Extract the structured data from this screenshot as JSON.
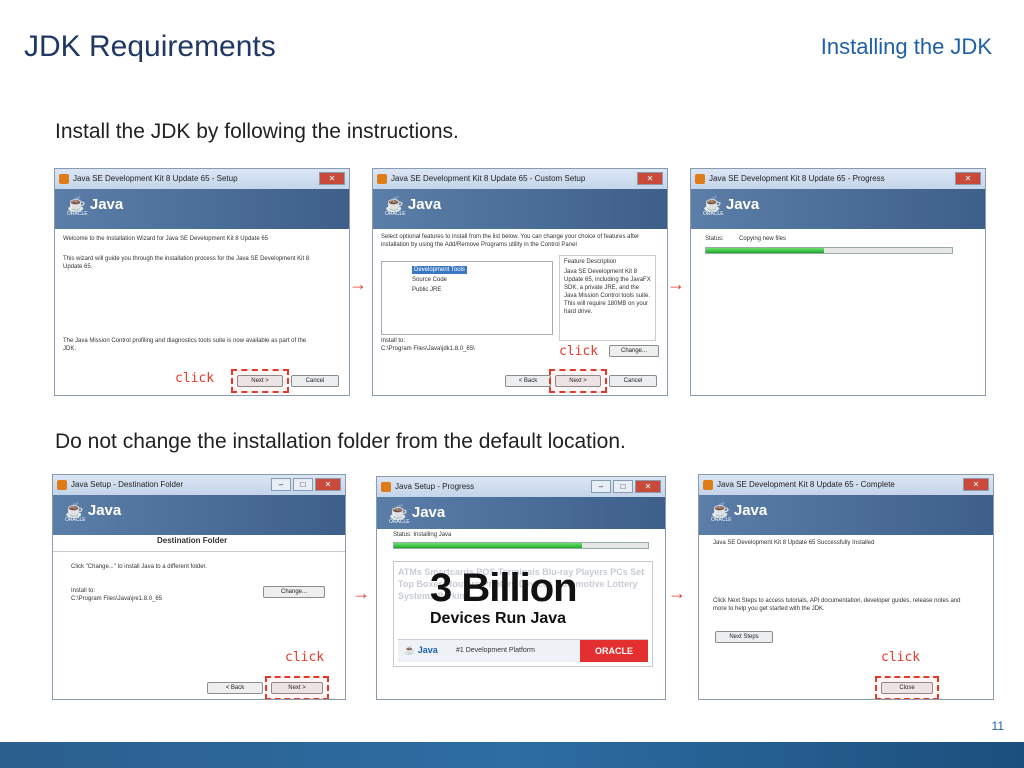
{
  "header": {
    "title": "JDK Requirements",
    "section": "Installing the JDK"
  },
  "instructions": {
    "step1": "Install the JDK by following the instructions.",
    "step2": "Do not change the installation folder from the default location."
  },
  "click_label": "click",
  "page_number": "11",
  "screenshots": {
    "s1": {
      "title": "Java SE Development Kit 8 Update 65 - Setup",
      "welcome": "Welcome to the Installation Wizard for Java SE Development Kit 8 Update 65",
      "body": "This wizard will guide you through the installation process for the Java SE Development Kit 8 Update 65.",
      "footer": "The Java Mission Control profiling and diagnostics tools suite is now available as part of the JDK.",
      "next": "Next >",
      "cancel": "Cancel"
    },
    "s2": {
      "title": "Java SE Development Kit 8 Update 65 - Custom Setup",
      "intro": "Select optional features to install from the list below. You can change your choice of features after installation by using the Add/Remove Programs utility in the Control Panel",
      "features": [
        "Development Tools",
        "Source Code",
        "Public JRE"
      ],
      "desc_title": "Feature Description",
      "desc": "Java SE Development Kit 8 Update 65, including the JavaFX SDK, a private JRE, and the Java Mission Control tools suite. This will require 180MB on your hard drive.",
      "install_to_label": "Install to:",
      "install_to": "C:\\Program Files\\Java\\jdk1.8.0_65\\",
      "change": "Change...",
      "back": "< Back",
      "next": "Next >",
      "cancel": "Cancel"
    },
    "s3": {
      "title": "Java SE Development Kit 8 Update 65 - Progress",
      "status_label": "Status:",
      "status": "Copying new files",
      "progress": 0.48
    },
    "s4": {
      "title": "Java Setup - Destination Folder",
      "heading": "Destination Folder",
      "prompt": "Click \"Change...\" to install Java to a different folder.",
      "install_to_label": "Install to:",
      "install_to": "C:\\Program Files\\Java\\jre1.8.0_65",
      "change": "Change...",
      "back": "< Back",
      "next": "Next >"
    },
    "s5": {
      "title": "Java Setup - Progress",
      "status": "Status:  Installing Java",
      "progress": 0.74,
      "ad_words": "ATMs  Smartcards  POS  Terminals  Blu-ray  Players  PCs  Set  Top  Boxes  Routers  Printers  Devices  Automotive  Lottery  Systems  Parking",
      "ad_big": "3 Billion",
      "ad_sub": "Devices Run Java",
      "ad_java": "Java",
      "ad_tagline": "#1 Development Platform",
      "ad_oracle": "ORACLE"
    },
    "s6": {
      "title": "Java SE Development Kit 8 Update 65 - Complete",
      "success": "Java SE Development Kit 8 Update 65 Successfully Installed",
      "body": "Click Next Steps to access tutorials, API documentation, developer guides, release notes and more to help you get started with the JDK.",
      "next_steps": "Next Steps",
      "close": "Close"
    }
  },
  "java_logo": "Java",
  "oracle_small": "ORACLE"
}
